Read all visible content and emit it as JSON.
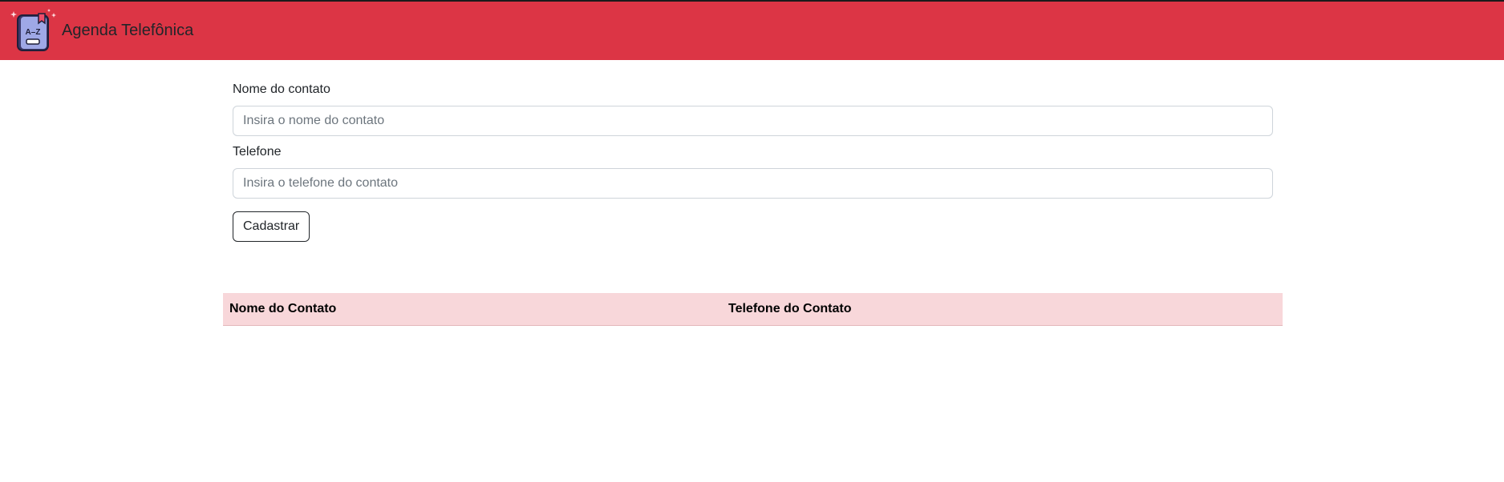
{
  "navbar": {
    "brand_title": "Agenda Telefônica",
    "logo_text": "A–Z",
    "logo_icon": "phone-book-icon",
    "background_color": "#dc3545"
  },
  "form": {
    "name_label": "Nome do contato",
    "name_placeholder": "Insira o nome do contato",
    "name_value": "",
    "phone_label": "Telefone",
    "phone_placeholder": "Insira o telefone do contato",
    "phone_value": "",
    "submit_label": "Cadastrar"
  },
  "table": {
    "columns": [
      "Nome do Contato",
      "Telefone do Contato"
    ],
    "rows": [],
    "header_color": "#f8d7da"
  }
}
